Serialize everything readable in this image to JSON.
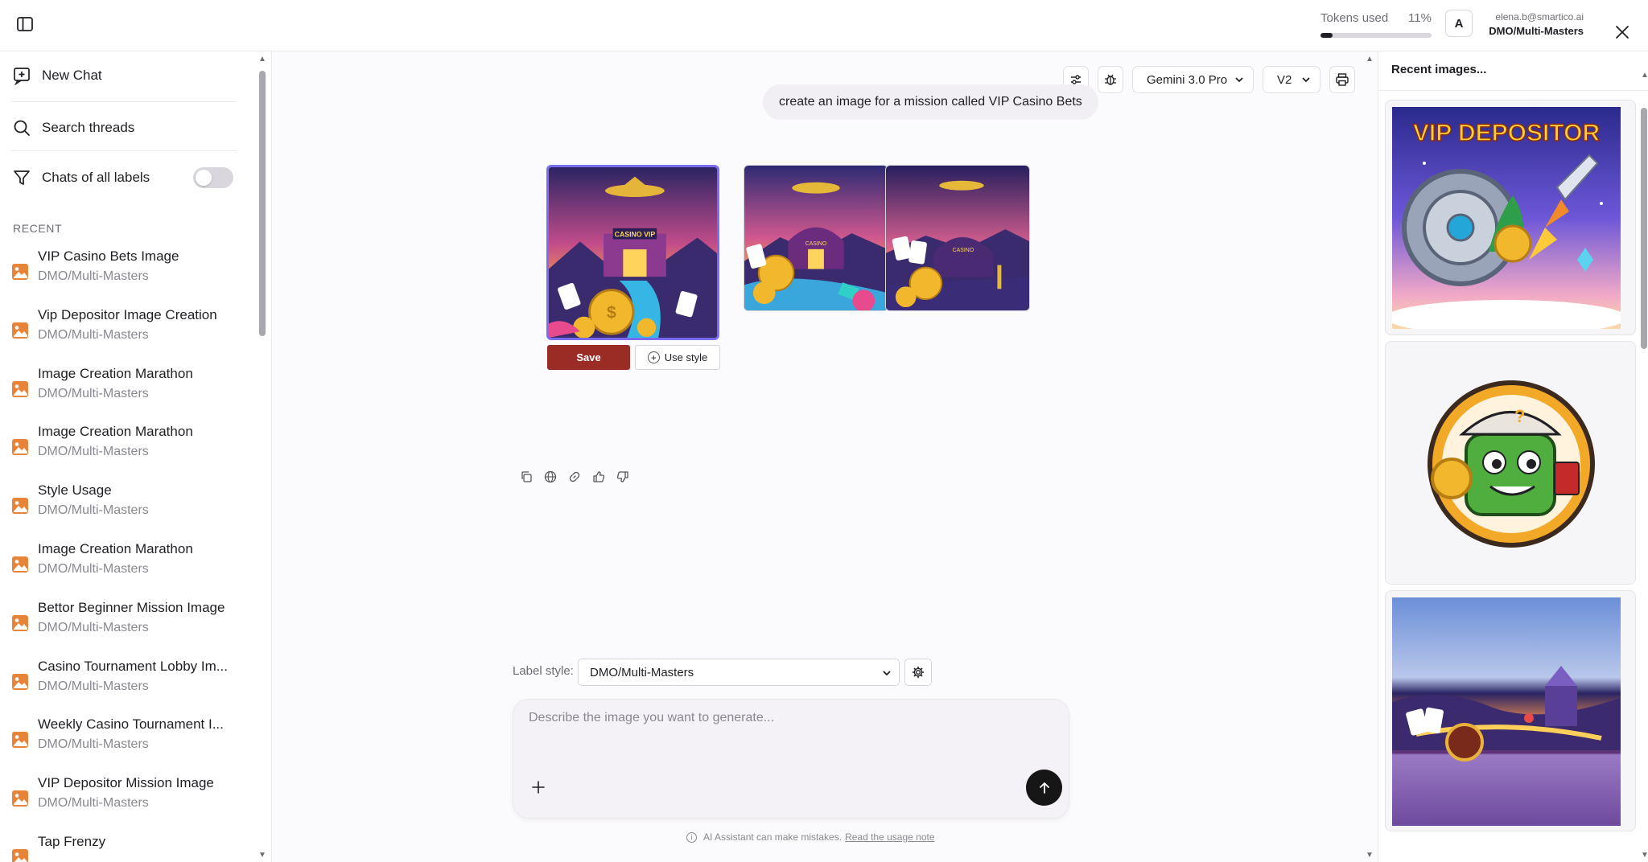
{
  "header": {
    "tokens_label": "Tokens used",
    "tokens_pct": "11%",
    "tokens_fraction": 0.11,
    "avatar_letter": "A",
    "user_email": "elena.b@smartico.ai",
    "user_org": "DMO/Multi-Masters"
  },
  "sidebar": {
    "new_chat": "New Chat",
    "search": "Search threads",
    "filter_label": "Chats of all labels",
    "filter_on": false,
    "recent_header": "RECENT",
    "threads": [
      {
        "title": "VIP Casino Bets Image",
        "label": "DMO/Multi-Masters"
      },
      {
        "title": "Vip Depositor Image Creation",
        "label": "DMO/Multi-Masters"
      },
      {
        "title": "Image Creation Marathon",
        "label": "DMO/Multi-Masters"
      },
      {
        "title": "Image Creation Marathon",
        "label": "DMO/Multi-Masters"
      },
      {
        "title": "Style Usage",
        "label": "DMO/Multi-Masters"
      },
      {
        "title": "Image Creation Marathon",
        "label": "DMO/Multi-Masters"
      },
      {
        "title": "Bettor Beginner Mission Image",
        "label": "DMO/Multi-Masters"
      },
      {
        "title": "Casino Tournament Lobby Im...",
        "label": "DMO/Multi-Masters"
      },
      {
        "title": "Weekly Casino Tournament I...",
        "label": "DMO/Multi-Masters"
      },
      {
        "title": "VIP Depositor Mission Image",
        "label": "DMO/Multi-Masters"
      },
      {
        "title": "Tap Frenzy",
        "label": ""
      }
    ]
  },
  "chat": {
    "model": "Gemini 3.0 Pro",
    "version": "V2",
    "user_message": "create an image for a mission called VIP Casino Bets",
    "image_signs": [
      "CASINO VIP",
      "CASINO",
      "CASINO"
    ],
    "save_label": "Save",
    "use_style_label": "Use style",
    "label_style_caption": "Label style:",
    "label_style_value": "DMO/Multi-Masters",
    "composer_placeholder": "Describe the image you want to generate...",
    "disclaimer": "AI Assistant can make mistakes.",
    "disclaimer_link": "Read the usage note"
  },
  "right_panel": {
    "title": "Recent images...",
    "card1_text": "VIP DEPOSITOR"
  },
  "colors": {
    "accent": "#9b2b25",
    "selected_border": "#7a6cf0",
    "thread_icon": "#e8833a",
    "send_button": "#161616"
  },
  "icons": [
    "sidebar-toggle-icon",
    "close-icon",
    "new-chat-icon",
    "search-icon",
    "filter-icon",
    "image-icon",
    "sliders-icon",
    "bug-icon",
    "chevron-down-icon",
    "print-icon",
    "copy-icon",
    "globe-icon",
    "link-icon",
    "thumbs-up-icon",
    "thumbs-down-icon",
    "gear-icon",
    "plus-icon",
    "arrow-up-icon",
    "info-icon"
  ]
}
